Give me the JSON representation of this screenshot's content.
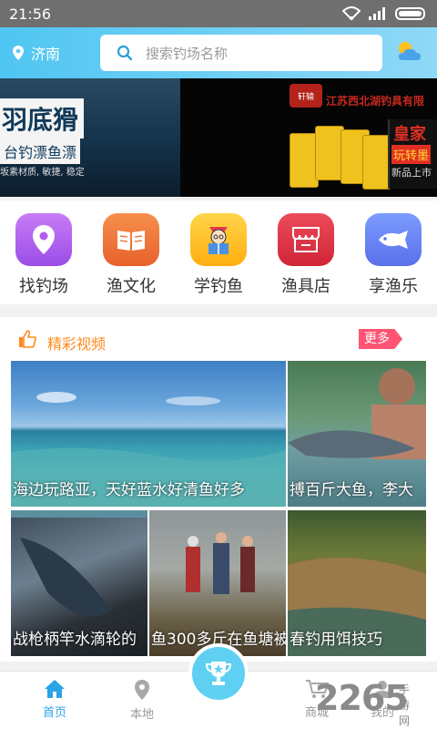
{
  "status_bar": {
    "time": "21:56"
  },
  "header": {
    "location": "济南",
    "search_placeholder": "搜索钓场名称"
  },
  "banner": {
    "left_title": "羽底猾",
    "left_subtitle": "台钓漂鱼漂",
    "left_tagline": "坂素材质, 敏捷, 稳定",
    "right_brand": "江苏西北湖钓具有限",
    "right_logo": "轩辕",
    "royal_title": "皇家",
    "royal_sub": "玩转墨",
    "royal_new": "新品上市",
    "slide_count": 4,
    "active_slide": 2
  },
  "categories": [
    {
      "label": "找钓场",
      "icon": "location-pin-icon",
      "color": "#b45cf0"
    },
    {
      "label": "渔文化",
      "icon": "book-icon",
      "color": "#f07a3c"
    },
    {
      "label": "学钓鱼",
      "icon": "reading-person-icon",
      "color": "#ffc21c"
    },
    {
      "label": "渔具店",
      "icon": "shop-icon",
      "color": "#e23a4c"
    },
    {
      "label": "享渔乐",
      "icon": "fish-icon",
      "color": "#6b8af6"
    }
  ],
  "video_section": {
    "title": "精彩视频",
    "more": "更多",
    "videos": [
      {
        "caption": "海边玩路亚，天好蓝水好清鱼好多"
      },
      {
        "caption": "搏百斤大鱼，李大"
      },
      {
        "caption": "战枪柄竿水滴轮的"
      },
      {
        "caption": "鱼300多斤在鱼塘被"
      },
      {
        "caption": "春钓用饵技巧"
      }
    ]
  },
  "bottom_nav": [
    {
      "label": "首页",
      "icon": "home-icon"
    },
    {
      "label": "本地",
      "icon": "map-pin-icon"
    },
    {
      "label": "",
      "icon": "trophy-icon"
    },
    {
      "label": "商城",
      "icon": "cart-icon"
    },
    {
      "label": "我的",
      "icon": "user-icon"
    }
  ],
  "watermark": {
    "number": "2265",
    "site": "手游网"
  },
  "colors": {
    "accent": "#2aa3e8",
    "header": "#4fc6f2",
    "more_badge": "#ff5473",
    "section_title": "#ff8a1c"
  }
}
